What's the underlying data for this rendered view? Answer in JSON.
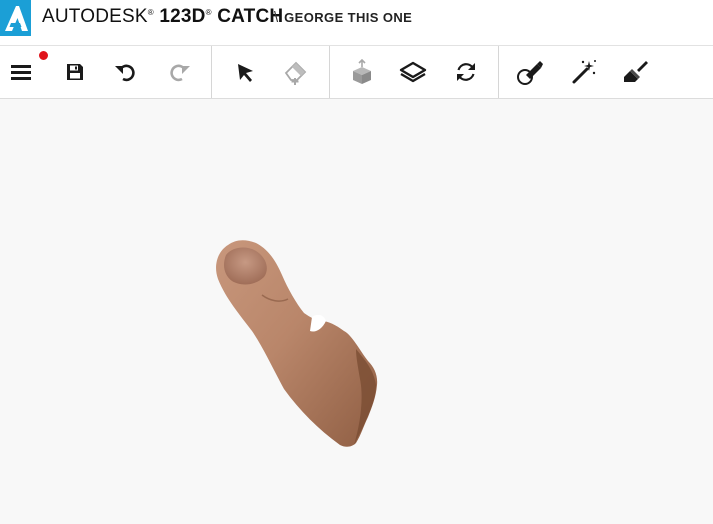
{
  "header": {
    "brand_name": "AUTODESK",
    "product_name": "123D",
    "product_sub": "CATCH",
    "reg_mark": "®",
    "separator": "\\",
    "project_name": "GEORGE THIS ONE"
  },
  "colors": {
    "brand_blue": "#1b9fd6",
    "notification_red": "#e0141c",
    "icon_dark": "#1a1a1a",
    "icon_disabled": "#a8a8a8",
    "viewport_bg": "#f8f8f8"
  },
  "toolbar": {
    "icons": [
      "menu-icon",
      "save-icon",
      "undo-icon",
      "redo-icon",
      "select-arrow-icon",
      "eraser-add-icon",
      "box-import-icon",
      "layers-icon",
      "refresh-icon",
      "brush-stroke-icon",
      "magic-wand-icon",
      "paint-brush-icon"
    ],
    "disabled": [
      "redo-icon",
      "eraser-add-icon",
      "box-import-icon"
    ],
    "has_notification": true
  },
  "viewport": {
    "object": "3D scanned thumb model"
  }
}
